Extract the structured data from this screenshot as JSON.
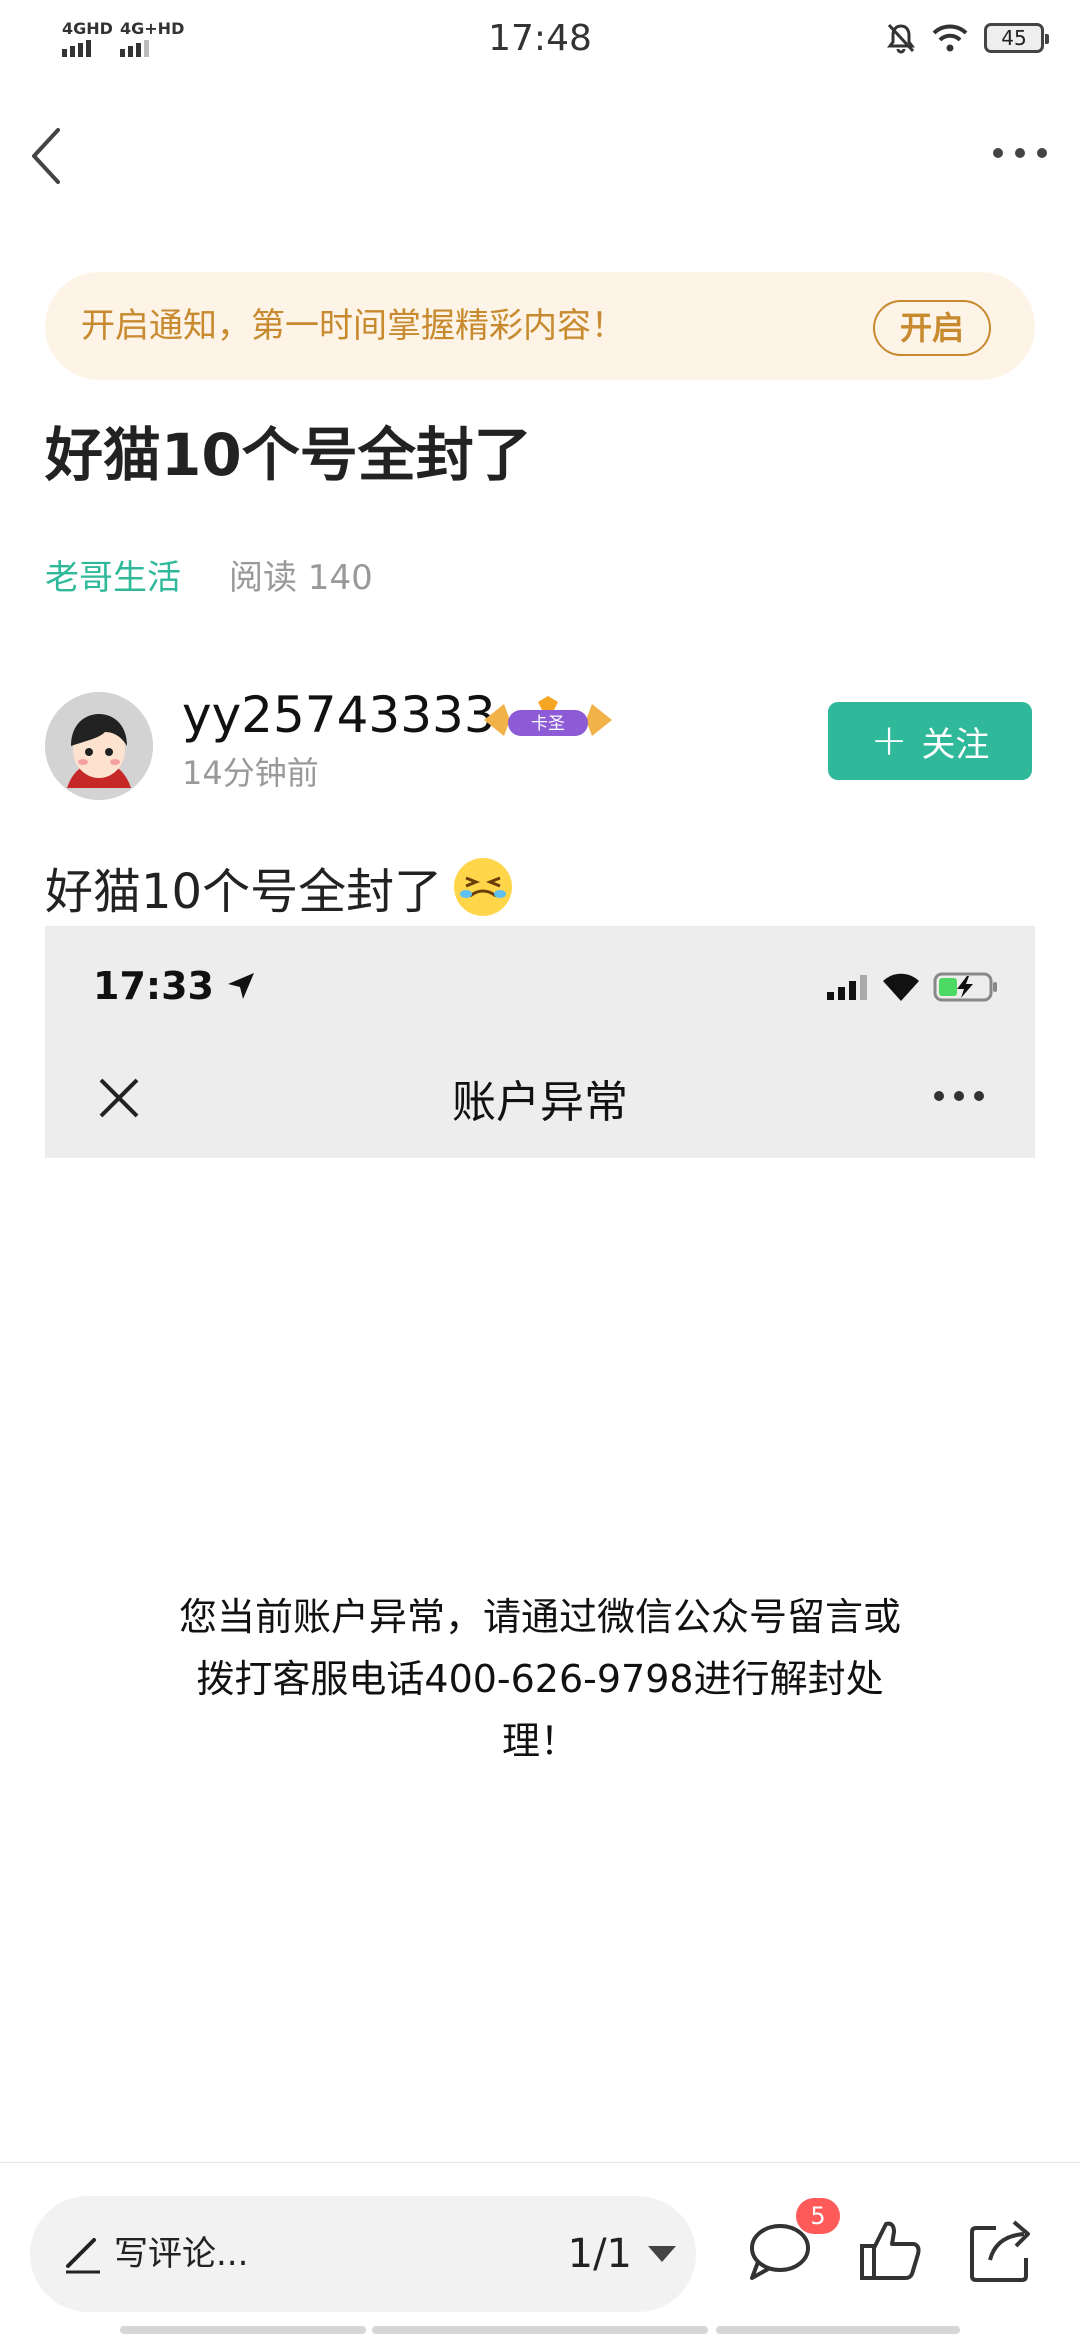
{
  "status_bar": {
    "time": "17:48",
    "network_1": "4GHD",
    "network_2": "4G+HD",
    "battery": "45"
  },
  "notify": {
    "text": "开启通知，第一时间掌握精彩内容！",
    "button": "开启"
  },
  "article": {
    "title": "好猫10个号全封了",
    "category": "老哥生活",
    "reads": "阅读 140"
  },
  "author": {
    "name": "yy25743333",
    "badge": "卡圣",
    "time_ago": "14分钟前",
    "follow_label": "关注"
  },
  "post": {
    "text": "好猫10个号全封了"
  },
  "embedded_screenshot": {
    "time": "17:33",
    "title": "账户异常",
    "message": "您当前账户异常，请通过微信公众号留言或拨打客服电话400-626-9798进行解封处理！"
  },
  "bottom_bar": {
    "comment_placeholder": "写评论...",
    "page_indicator": "1/1",
    "comment_count": "5"
  },
  "colors": {
    "accent": "#2fb99a",
    "notify_bg": "#fdf3e6",
    "notify_text": "#c88a2e",
    "badge_red": "#ff5a5a"
  }
}
